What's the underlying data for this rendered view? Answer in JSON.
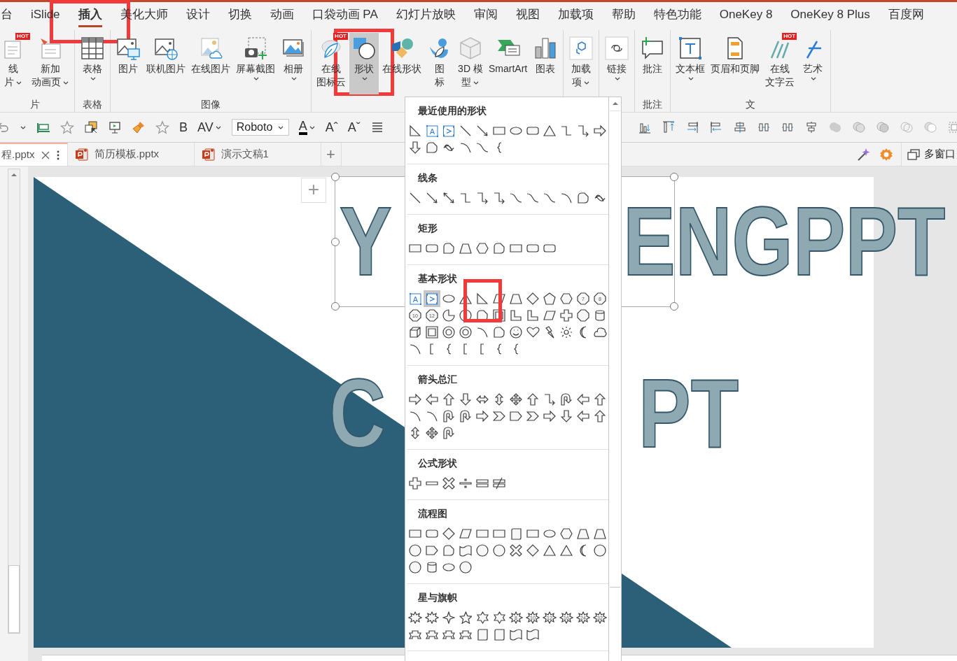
{
  "menu_tabs": [
    {
      "label": "台",
      "selected": false,
      "highlighted": false
    },
    {
      "label": "iSlide",
      "selected": false,
      "highlighted": false
    },
    {
      "label": "插入",
      "selected": true,
      "highlighted": true
    },
    {
      "label": "美化大师",
      "selected": false,
      "highlighted": false
    },
    {
      "label": "设计",
      "selected": false,
      "highlighted": false
    },
    {
      "label": "切换",
      "selected": false,
      "highlighted": false
    },
    {
      "label": "动画",
      "selected": false,
      "highlighted": false
    },
    {
      "label": "口袋动画 PA",
      "selected": false,
      "highlighted": false
    },
    {
      "label": "幻灯片放映",
      "selected": false,
      "highlighted": false
    },
    {
      "label": "审阅",
      "selected": false,
      "highlighted": false
    },
    {
      "label": "视图",
      "selected": false,
      "highlighted": false
    },
    {
      "label": "加载项",
      "selected": false,
      "highlighted": false
    },
    {
      "label": "帮助",
      "selected": false,
      "highlighted": false
    },
    {
      "label": "特色功能",
      "selected": false,
      "highlighted": false
    },
    {
      "label": "OneKey 8",
      "selected": false,
      "highlighted": false
    },
    {
      "label": "OneKey 8 Plus",
      "selected": false,
      "highlighted": false
    },
    {
      "label": "百度网",
      "selected": false,
      "highlighted": false
    }
  ],
  "ribbon": {
    "groups": [
      {
        "label": "片",
        "buttons": [
          {
            "kind": "online-slide",
            "lines": [
              "线",
              "片"
            ],
            "badge": "HOT",
            "dropdown": true,
            "pressed": false,
            "highlighted": false
          },
          {
            "kind": "new-anim",
            "lines": [
              "新加",
              "动画页"
            ],
            "dropdown": true,
            "pressed": false,
            "highlighted": false
          }
        ]
      },
      {
        "label": "表格",
        "buttons": [
          {
            "kind": "table",
            "label": "表格",
            "dropdown": true,
            "pressed": false,
            "highlighted": false
          }
        ]
      },
      {
        "label": "图像",
        "buttons": [
          {
            "kind": "picture-screen",
            "label": "图片",
            "dropdown": false,
            "pressed": false,
            "highlighted": false
          },
          {
            "kind": "picture-globe",
            "label": "联机图片",
            "dropdown": false,
            "pressed": false,
            "highlighted": false
          },
          {
            "kind": "picture-cloud",
            "label": "在线图片",
            "dropdown": false,
            "pressed": false,
            "highlighted": false
          },
          {
            "kind": "screenshot",
            "label": "屏幕截图",
            "dropdown": true,
            "pressed": false,
            "highlighted": false
          },
          {
            "kind": "album",
            "label": "相册",
            "dropdown": true,
            "pressed": false,
            "highlighted": false
          }
        ]
      },
      {
        "buttons": [
          {
            "kind": "leaf",
            "lines": [
              "在线",
              "图标云"
            ],
            "badge": "HOT",
            "dropdown": false,
            "pressed": false,
            "highlighted": false
          },
          {
            "kind": "shapes",
            "label": "形状",
            "dropdown": true,
            "pressed": true,
            "highlighted": true
          },
          {
            "kind": "online-shapes",
            "label": "在线形状",
            "dropdown": false,
            "pressed": false,
            "highlighted": false
          },
          {
            "kind": "bird",
            "lines": [
              "图",
              "标"
            ],
            "dropdown": false,
            "pressed": false,
            "highlighted": false
          },
          {
            "kind": "cube3d",
            "lines": [
              "3D 模",
              "型"
            ],
            "dropdown": true,
            "pressed": false,
            "highlighted": false
          },
          {
            "kind": "smartart",
            "label": "SmartArt",
            "dropdown": false,
            "pressed": false,
            "highlighted": false
          },
          {
            "kind": "chart",
            "label": "图表",
            "dropdown": false,
            "pressed": false,
            "highlighted": false
          }
        ]
      },
      {
        "buttons": [
          {
            "kind": "addin",
            "lines": [
              "加载",
              "项"
            ],
            "dropdown": true,
            "pressed": false,
            "highlighted": false
          }
        ]
      },
      {
        "buttons": [
          {
            "kind": "link",
            "label": "链接",
            "dropdown": true,
            "pressed": false,
            "highlighted": false
          }
        ]
      },
      {
        "label": "批注",
        "buttons": [
          {
            "kind": "comment",
            "label": "批注",
            "dropdown": false,
            "pressed": false,
            "highlighted": false
          }
        ]
      },
      {
        "label": "文",
        "buttons": [
          {
            "kind": "textbox",
            "label": "文本框",
            "dropdown": true,
            "pressed": false,
            "highlighted": false
          },
          {
            "kind": "header",
            "label": "页眉和页脚",
            "dropdown": false,
            "pressed": false,
            "highlighted": false
          },
          {
            "kind": "wordcloud",
            "lines": [
              "在线",
              "文字云"
            ],
            "badge": "HOT",
            "dropdown": false,
            "pressed": false,
            "highlighted": false
          },
          {
            "kind": "wordart",
            "label": "艺术",
            "dropdown": true,
            "pressed": false,
            "highlighted": false
          }
        ]
      }
    ]
  },
  "toolbar": {
    "items": [
      {
        "kind": "undo"
      },
      {
        "kind": "caret"
      },
      {
        "kind": "fill-bar"
      },
      {
        "kind": "star"
      },
      {
        "kind": "select"
      },
      {
        "kind": "present"
      },
      {
        "kind": "brush"
      },
      {
        "kind": "star"
      },
      {
        "kind": "text",
        "label": "B"
      },
      {
        "kind": "text",
        "label": "AV",
        "caret": true
      },
      {
        "kind": "font-field",
        "value": "Roboto"
      },
      {
        "kind": "font-color",
        "label": "A",
        "caret": true
      },
      {
        "kind": "text",
        "label": "Aˆ"
      },
      {
        "kind": "text",
        "label": "Aˇ"
      },
      {
        "kind": "lines"
      }
    ],
    "right_items": [
      {
        "kind": "align-bottom"
      },
      {
        "kind": "align-top"
      },
      {
        "kind": "align-right"
      },
      {
        "kind": "align-left"
      },
      {
        "kind": "center-v"
      },
      {
        "kind": "distribute"
      },
      {
        "kind": "distribute"
      },
      {
        "kind": "center-h"
      },
      {
        "kind": "union"
      },
      {
        "kind": "combine"
      },
      {
        "kind": "fragment"
      },
      {
        "kind": "intersect"
      },
      {
        "kind": "subtract"
      },
      {
        "kind": "group"
      }
    ]
  },
  "doc_tabs": [
    {
      "label": "程.pptx",
      "selected": true
    },
    {
      "label": "简历模板.pptx",
      "selected": false
    },
    {
      "label": "演示文稿1",
      "selected": false
    }
  ],
  "new_tab": "+",
  "window_button": "多窗口",
  "slide": {
    "title_parts": [
      "Y",
      "ENGPPT",
      "C",
      "PT"
    ],
    "add_button": "+"
  },
  "shapes_menu": {
    "sections": [
      {
        "title": "最近使用的形状",
        "shapes": [
          {
            "kind": "rtri"
          },
          {
            "kind": "tbox",
            "label": "A"
          },
          {
            "kind": "vtbox"
          },
          {
            "kind": "line"
          },
          {
            "kind": "aline"
          },
          {
            "kind": "rect"
          },
          {
            "kind": "ell"
          },
          {
            "kind": "rrect"
          },
          {
            "kind": "tri"
          },
          {
            "kind": "elbow"
          },
          {
            "kind": "elbowa"
          },
          {
            "kind": "rarr"
          },
          {
            "kind": "darr"
          },
          {
            "kind": "free"
          },
          {
            "kind": "scrib"
          },
          {
            "kind": "arc"
          },
          {
            "kind": "curve"
          },
          {
            "kind": "brace"
          }
        ]
      },
      {
        "title": "线条",
        "shapes": [
          {
            "kind": "line"
          },
          {
            "kind": "aline"
          },
          {
            "kind": "dline"
          },
          {
            "kind": "elbow"
          },
          {
            "kind": "elbowa"
          },
          {
            "kind": "elbowa"
          },
          {
            "kind": "curve"
          },
          {
            "kind": "curve"
          },
          {
            "kind": "curve"
          },
          {
            "kind": "arc"
          },
          {
            "kind": "free"
          },
          {
            "kind": "scrib"
          }
        ]
      },
      {
        "title": "矩形",
        "shapes": [
          {
            "kind": "rect"
          },
          {
            "kind": "rrect"
          },
          {
            "kind": "free"
          },
          {
            "kind": "trap"
          },
          {
            "kind": "hex"
          },
          {
            "kind": "free"
          },
          {
            "kind": "rect"
          },
          {
            "kind": "rrect"
          },
          {
            "kind": "rrect"
          }
        ]
      },
      {
        "title": "基本形状",
        "shapes": [
          {
            "kind": "tbox",
            "label": "A",
            "hovered": false,
            "highlighted": false
          },
          {
            "kind": "vtbox",
            "hovered": true,
            "highlighted": false
          },
          {
            "kind": "ell",
            "hovered": false,
            "highlighted": false
          },
          {
            "kind": "tri",
            "hovered": false,
            "highlighted": false
          },
          {
            "kind": "rtri",
            "hovered": false,
            "highlighted": true
          },
          {
            "kind": "para"
          },
          {
            "kind": "trap"
          },
          {
            "kind": "diam"
          },
          {
            "kind": "pent"
          },
          {
            "kind": "hex"
          },
          {
            "kind": "oct",
            "label": "7"
          },
          {
            "kind": "oct",
            "label": "8"
          },
          {
            "kind": "oct",
            "label": "10"
          },
          {
            "kind": "oct",
            "label": "12"
          },
          {
            "kind": "pie"
          },
          {
            "kind": "circ"
          },
          {
            "kind": "free"
          },
          {
            "kind": "frame"
          },
          {
            "kind": "lshape"
          },
          {
            "kind": "lshape"
          },
          {
            "kind": "para"
          },
          {
            "kind": "plus"
          },
          {
            "kind": "oct"
          },
          {
            "kind": "can"
          },
          {
            "kind": "cube"
          },
          {
            "kind": "frame"
          },
          {
            "kind": "donut"
          },
          {
            "kind": "donut"
          },
          {
            "kind": "arc"
          },
          {
            "kind": "free"
          },
          {
            "kind": "smile"
          },
          {
            "kind": "heart"
          },
          {
            "kind": "bolt"
          },
          {
            "kind": "sun"
          },
          {
            "kind": "moon"
          },
          {
            "kind": "cloud"
          },
          {
            "kind": "arc"
          },
          {
            "kind": "bracket"
          },
          {
            "kind": "brace"
          },
          {
            "kind": "bracket"
          },
          {
            "kind": "bracket"
          },
          {
            "kind": "brace"
          },
          {
            "kind": "brace"
          }
        ]
      },
      {
        "title": "箭头总汇",
        "shapes": [
          {
            "kind": "rarr"
          },
          {
            "kind": "larr"
          },
          {
            "kind": "uarr"
          },
          {
            "kind": "darr"
          },
          {
            "kind": "lrarr"
          },
          {
            "kind": "udarr"
          },
          {
            "kind": "qarr"
          },
          {
            "kind": "uarr"
          },
          {
            "kind": "elbowa"
          },
          {
            "kind": "uturn"
          },
          {
            "kind": "larr"
          },
          {
            "kind": "uarr"
          },
          {
            "kind": "arc"
          },
          {
            "kind": "arc"
          },
          {
            "kind": "uturn"
          },
          {
            "kind": "uturn"
          },
          {
            "kind": "rarr"
          },
          {
            "kind": "chev"
          },
          {
            "kind": "penta"
          },
          {
            "kind": "chev"
          },
          {
            "kind": "rarr"
          },
          {
            "kind": "darr"
          },
          {
            "kind": "larr"
          },
          {
            "kind": "uarr"
          },
          {
            "kind": "udarr"
          },
          {
            "kind": "qarr"
          },
          {
            "kind": "uturn"
          }
        ]
      },
      {
        "title": "公式形状",
        "shapes": [
          {
            "kind": "plus"
          },
          {
            "kind": "minus"
          },
          {
            "kind": "x"
          },
          {
            "kind": "div"
          },
          {
            "kind": "eq"
          },
          {
            "kind": "neq"
          }
        ]
      },
      {
        "title": "流程图",
        "shapes": [
          {
            "kind": "rect"
          },
          {
            "kind": "rrect"
          },
          {
            "kind": "diam"
          },
          {
            "kind": "para"
          },
          {
            "kind": "rect"
          },
          {
            "kind": "rect"
          },
          {
            "kind": "scroll"
          },
          {
            "kind": "rect"
          },
          {
            "kind": "ell"
          },
          {
            "kind": "hex"
          },
          {
            "kind": "trap"
          },
          {
            "kind": "trap"
          },
          {
            "kind": "circ"
          },
          {
            "kind": "penta"
          },
          {
            "kind": "free"
          },
          {
            "kind": "wave"
          },
          {
            "kind": "circ"
          },
          {
            "kind": "circ"
          },
          {
            "kind": "x"
          },
          {
            "kind": "diam"
          },
          {
            "kind": "tri"
          },
          {
            "kind": "tri"
          },
          {
            "kind": "moon"
          },
          {
            "kind": "circ"
          },
          {
            "kind": "circ"
          },
          {
            "kind": "can"
          },
          {
            "kind": "ell"
          },
          {
            "kind": "circ"
          }
        ]
      },
      {
        "title": "星与旗帜",
        "shapes": [
          {
            "kind": "burst"
          },
          {
            "kind": "burst"
          },
          {
            "kind": "star4"
          },
          {
            "kind": "star5"
          },
          {
            "kind": "star6"
          },
          {
            "kind": "star6"
          },
          {
            "kind": "burst",
            "label": "8"
          },
          {
            "kind": "burst",
            "label": "10"
          },
          {
            "kind": "burst",
            "label": "12"
          },
          {
            "kind": "burst",
            "label": "16"
          },
          {
            "kind": "burst",
            "label": "24"
          },
          {
            "kind": "burst",
            "label": "32"
          },
          {
            "kind": "ribbon"
          },
          {
            "kind": "ribbon"
          },
          {
            "kind": "ribbon"
          },
          {
            "kind": "ribbon"
          },
          {
            "kind": "scroll"
          },
          {
            "kind": "scroll"
          },
          {
            "kind": "wave"
          },
          {
            "kind": "wave"
          }
        ]
      }
    ]
  }
}
